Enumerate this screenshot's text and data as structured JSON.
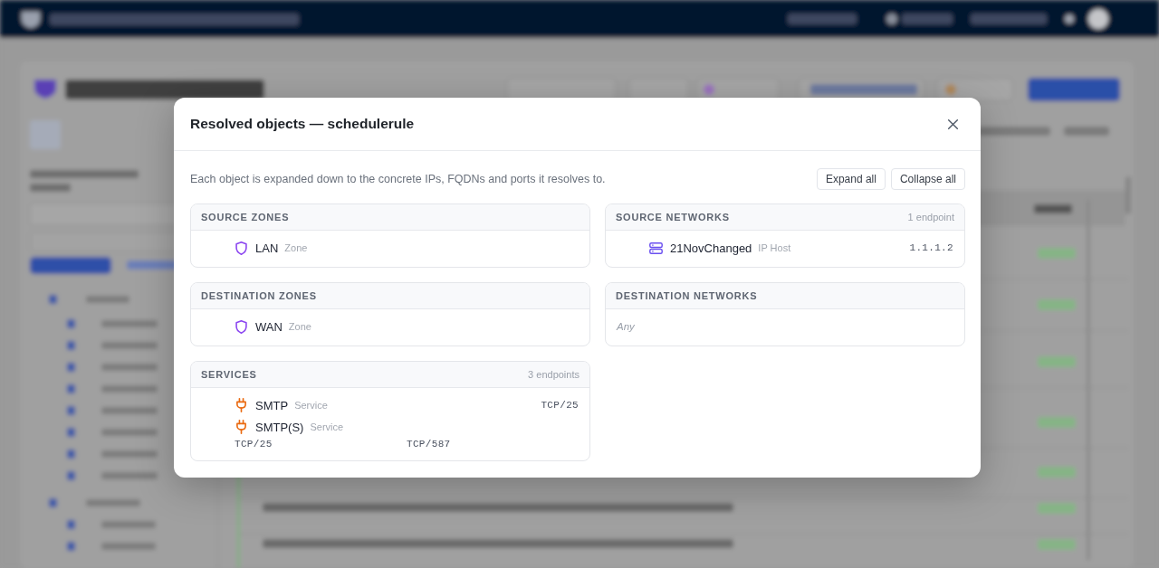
{
  "modal": {
    "title": "Resolved objects — schedulerule",
    "description": "Each object is expanded down to the concrete IPs, FQDNs and ports it resolves to.",
    "buttons": [
      "Expand all",
      "Collapse all"
    ]
  },
  "sections": [
    {
      "title": "SOURCE ZONES",
      "items": [
        {
          "kind": "zone",
          "name": "LAN",
          "type": "Zone"
        }
      ]
    },
    {
      "title": "SOURCE NETWORKS",
      "count": "1 endpoint",
      "items": [
        {
          "kind": "host",
          "name": "21NovChanged",
          "type": "IP Host",
          "values": [
            "1.1.1.2"
          ]
        }
      ]
    },
    {
      "title": "DESTINATION ZONES",
      "items": [
        {
          "kind": "zone",
          "name": "WAN",
          "type": "Zone"
        }
      ]
    },
    {
      "title": "DESTINATION NETWORKS",
      "empty": "Any"
    },
    {
      "title": "SERVICES",
      "count": "3 endpoints",
      "items": [
        {
          "kind": "service",
          "name": "SMTP",
          "type": "Service",
          "values": [
            "TCP/25"
          ]
        },
        {
          "kind": "service",
          "name": "SMTP(S)",
          "type": "Service",
          "values": [
            "TCP/25",
            "TCP/587"
          ]
        }
      ]
    }
  ]
}
